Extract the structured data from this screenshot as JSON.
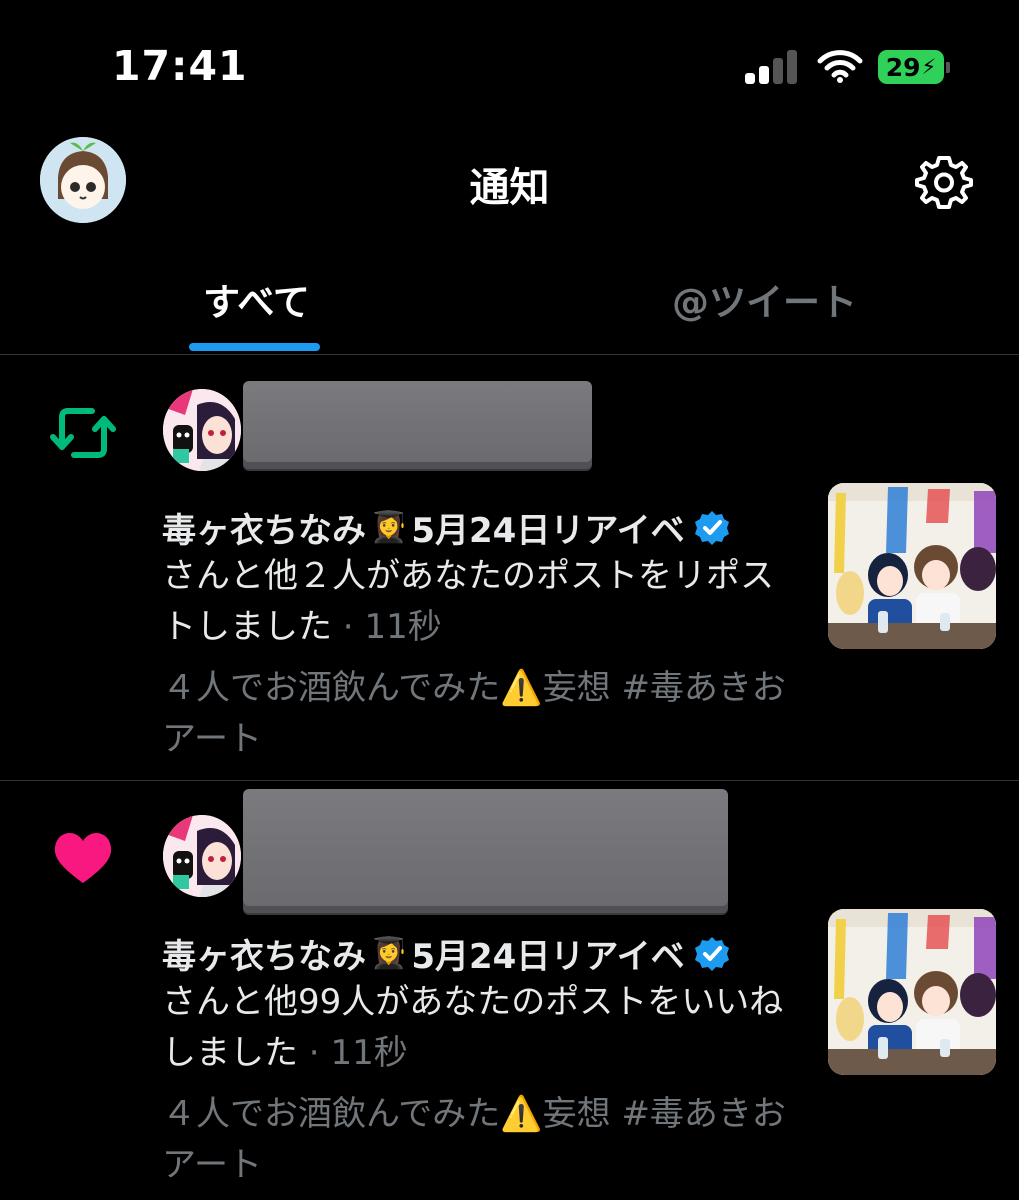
{
  "status_bar": {
    "time": "17:41",
    "battery": "29"
  },
  "header": {
    "title": "通知",
    "avatar_icon": "user-avatar",
    "settings_icon": "gear-icon"
  },
  "tabs": [
    {
      "label": "すべて",
      "selected": true
    },
    {
      "label": "@ツイート",
      "selected": false
    }
  ],
  "notifications": [
    {
      "type": "repost",
      "icon": "repost-icon",
      "icon_color": "#00ba7c",
      "actor_name": "毒ヶ衣ちなみ",
      "actor_emoji": "👩‍🎓",
      "actor_suffix": "5月24日リアイベ",
      "verified": true,
      "text": "さんと他２人があなたのポストをリポストしました",
      "time": "11秒",
      "preview": "４人でお酒飲んでみた⚠️妄想 #毒あきおアート"
    },
    {
      "type": "like",
      "icon": "heart-icon",
      "icon_color": "#f91880",
      "actor_name": "毒ヶ衣ちなみ",
      "actor_emoji": "👩‍🎓",
      "actor_suffix": "5月24日リアイベ",
      "verified": true,
      "text": "さんと他99人があなたのポストをいいねしました",
      "time": "11秒",
      "preview": "４人でお酒飲んでみた⚠️妄想 #毒あきおアート"
    }
  ]
}
